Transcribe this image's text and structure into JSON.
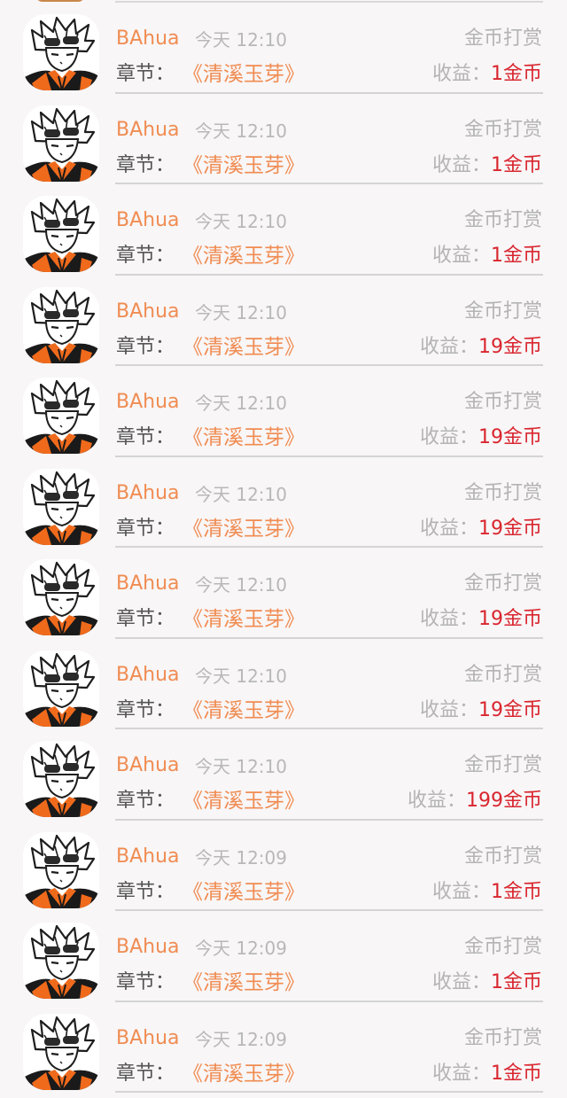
{
  "rows": [
    {
      "name": "BAhua",
      "time": "今天 12:10",
      "type": "金币打赏",
      "chapter_label": "章节：",
      "chapter_name": "《清溪玉芽》",
      "income_label": "收益：",
      "income_amount": "1金币"
    },
    {
      "name": "BAhua",
      "time": "今天 12:10",
      "type": "金币打赏",
      "chapter_label": "章节：",
      "chapter_name": "《清溪玉芽》",
      "income_label": "收益：",
      "income_amount": "1金币"
    },
    {
      "name": "BAhua",
      "time": "今天 12:10",
      "type": "金币打赏",
      "chapter_label": "章节：",
      "chapter_name": "《清溪玉芽》",
      "income_label": "收益：",
      "income_amount": "1金币"
    },
    {
      "name": "BAhua",
      "time": "今天 12:10",
      "type": "金币打赏",
      "chapter_label": "章节：",
      "chapter_name": "《清溪玉芽》",
      "income_label": "收益：",
      "income_amount": "19金币"
    },
    {
      "name": "BAhua",
      "time": "今天 12:10",
      "type": "金币打赏",
      "chapter_label": "章节：",
      "chapter_name": "《清溪玉芽》",
      "income_label": "收益：",
      "income_amount": "19金币"
    },
    {
      "name": "BAhua",
      "time": "今天 12:10",
      "type": "金币打赏",
      "chapter_label": "章节：",
      "chapter_name": "《清溪玉芽》",
      "income_label": "收益：",
      "income_amount": "19金币"
    },
    {
      "name": "BAhua",
      "time": "今天 12:10",
      "type": "金币打赏",
      "chapter_label": "章节：",
      "chapter_name": "《清溪玉芽》",
      "income_label": "收益：",
      "income_amount": "19金币"
    },
    {
      "name": "BAhua",
      "time": "今天 12:10",
      "type": "金币打赏",
      "chapter_label": "章节：",
      "chapter_name": "《清溪玉芽》",
      "income_label": "收益：",
      "income_amount": "19金币"
    },
    {
      "name": "BAhua",
      "time": "今天 12:10",
      "type": "金币打赏",
      "chapter_label": "章节：",
      "chapter_name": "《清溪玉芽》",
      "income_label": "收益：",
      "income_amount": "199金币"
    },
    {
      "name": "BAhua",
      "time": "今天 12:09",
      "type": "金币打赏",
      "chapter_label": "章节：",
      "chapter_name": "《清溪玉芽》",
      "income_label": "收益：",
      "income_amount": "1金币"
    },
    {
      "name": "BAhua",
      "time": "今天 12:09",
      "type": "金币打赏",
      "chapter_label": "章节：",
      "chapter_name": "《清溪玉芽》",
      "income_label": "收益：",
      "income_amount": "1金币"
    },
    {
      "name": "BAhua",
      "time": "今天 12:09",
      "type": "金币打赏",
      "chapter_label": "章节：",
      "chapter_name": "《清溪玉芽》",
      "income_label": "收益：",
      "income_amount": "1金币"
    }
  ],
  "colors": {
    "background": "#f8f6f7",
    "accent_orange": "#f08c52",
    "amount_red": "#d9262f",
    "muted_gray": "#b4b4b4",
    "divider": "#d4d4d4"
  },
  "icons": {
    "avatar": "user-avatar-manga-character-icon"
  }
}
